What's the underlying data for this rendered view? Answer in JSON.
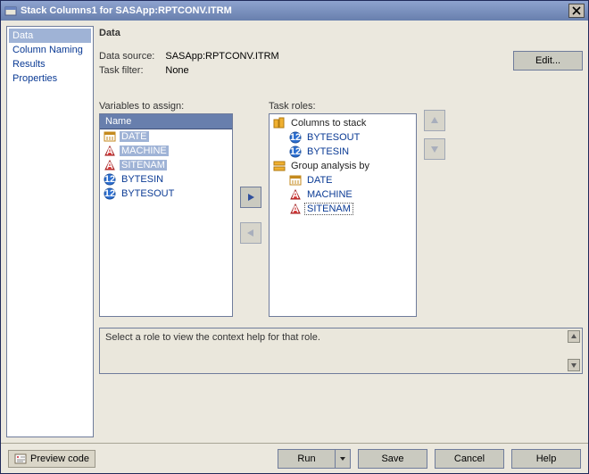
{
  "window": {
    "title": "Stack Columns1 for SASApp:RPTCONV.ITRM"
  },
  "nav": {
    "items": [
      {
        "label": "Data",
        "selected": true
      },
      {
        "label": "Column Naming",
        "selected": false
      },
      {
        "label": "Results",
        "selected": false
      },
      {
        "label": "Properties",
        "selected": false
      }
    ]
  },
  "main": {
    "heading": "Data",
    "dataSourceLabel": "Data source:",
    "dataSourceValue": "SASApp:RPTCONV.ITRM",
    "taskFilterLabel": "Task filter:",
    "taskFilterValue": "None",
    "editButton": "Edit...",
    "varsLabel": "Variables to assign:",
    "varsHeader": "Name",
    "vars": [
      {
        "name": "DATE",
        "icon": "date",
        "selected": true
      },
      {
        "name": "MACHINE",
        "icon": "char",
        "selected": true
      },
      {
        "name": "SITENAM",
        "icon": "char",
        "selected": true
      },
      {
        "name": "BYTESIN",
        "icon": "num",
        "selected": false
      },
      {
        "name": "BYTESOUT",
        "icon": "num",
        "selected": false
      }
    ],
    "rolesLabel": "Task roles:",
    "roles": [
      {
        "label": "Columns to stack",
        "icon": "stack",
        "children": [
          {
            "name": "BYTESOUT",
            "icon": "num"
          },
          {
            "name": "BYTESIN",
            "icon": "num"
          }
        ]
      },
      {
        "label": "Group analysis by",
        "icon": "group",
        "children": [
          {
            "name": "DATE",
            "icon": "date"
          },
          {
            "name": "MACHINE",
            "icon": "char"
          },
          {
            "name": "SITENAM",
            "icon": "char",
            "dotted": true
          }
        ]
      }
    ],
    "help": "Select a role to view the context help for that role."
  },
  "footer": {
    "preview": "Preview code",
    "run": "Run",
    "save": "Save",
    "cancel": "Cancel",
    "help": "Help"
  }
}
